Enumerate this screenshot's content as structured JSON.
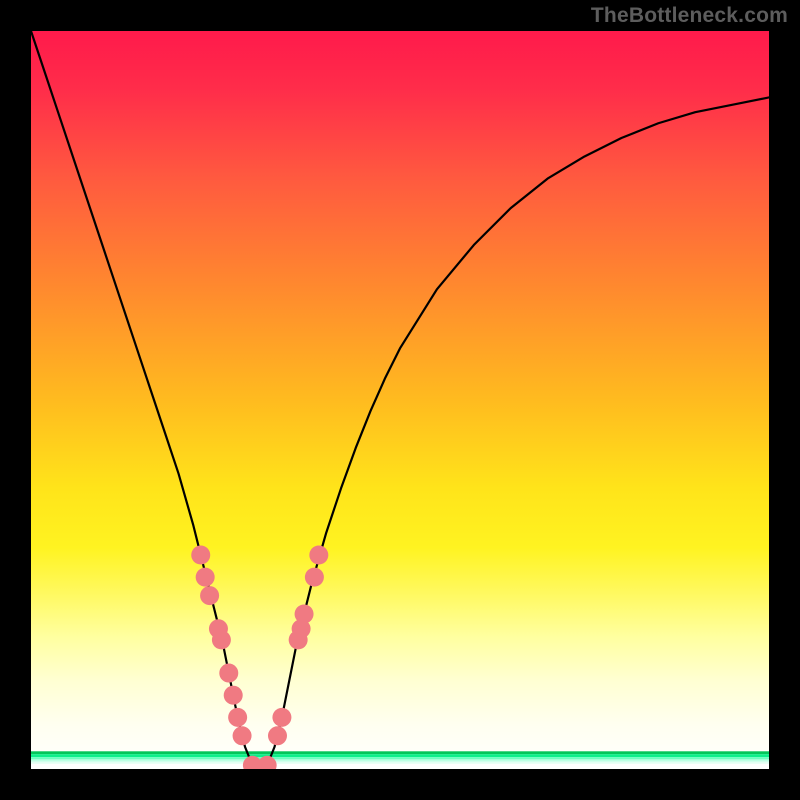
{
  "watermark": "TheBottleneck.com",
  "chart_data": {
    "type": "line",
    "title": "",
    "xlabel": "",
    "ylabel": "",
    "xlim": [
      0,
      100
    ],
    "ylim": [
      0,
      100
    ],
    "grid": false,
    "series": [
      {
        "name": "bottleneck-curve",
        "x": [
          0,
          2,
          4,
          6,
          8,
          10,
          12,
          14,
          16,
          18,
          20,
          22,
          24,
          25,
          26,
          27,
          28,
          29,
          30,
          31,
          32,
          33,
          34,
          35,
          36,
          38,
          40,
          42,
          44,
          46,
          48,
          50,
          55,
          60,
          65,
          70,
          75,
          80,
          85,
          90,
          95,
          100
        ],
        "y": [
          100,
          94,
          88,
          82,
          76,
          70,
          64,
          58,
          52,
          46,
          40,
          33,
          25,
          21,
          17,
          12,
          7,
          3,
          0.5,
          0,
          0.5,
          3,
          7,
          12,
          17,
          25,
          32,
          38,
          43.5,
          48.5,
          53,
          57,
          65,
          71,
          76,
          80,
          83,
          85.5,
          87.5,
          89,
          90,
          91
        ]
      }
    ],
    "markers": {
      "name": "solution-points",
      "color": "#f07a82",
      "points": [
        {
          "x": 23.0,
          "y": 29
        },
        {
          "x": 23.6,
          "y": 26
        },
        {
          "x": 24.2,
          "y": 23.5
        },
        {
          "x": 25.4,
          "y": 19
        },
        {
          "x": 25.8,
          "y": 17.5
        },
        {
          "x": 26.8,
          "y": 13
        },
        {
          "x": 27.4,
          "y": 10
        },
        {
          "x": 28.0,
          "y": 7
        },
        {
          "x": 28.6,
          "y": 4.5
        },
        {
          "x": 30.0,
          "y": 0.5
        },
        {
          "x": 31.0,
          "y": 0
        },
        {
          "x": 32.0,
          "y": 0.5
        },
        {
          "x": 33.4,
          "y": 4.5
        },
        {
          "x": 34.0,
          "y": 7
        },
        {
          "x": 36.2,
          "y": 17.5
        },
        {
          "x": 36.6,
          "y": 19
        },
        {
          "x": 37.0,
          "y": 21
        },
        {
          "x": 38.4,
          "y": 26
        },
        {
          "x": 39.0,
          "y": 29
        }
      ]
    },
    "background": {
      "type": "vertical-gradient-with-bands",
      "stops": [
        {
          "offset": 0.0,
          "color": "#ff1a4b"
        },
        {
          "offset": 0.08,
          "color": "#ff2d4a"
        },
        {
          "offset": 0.2,
          "color": "#ff5a3f"
        },
        {
          "offset": 0.35,
          "color": "#ff8a2e"
        },
        {
          "offset": 0.5,
          "color": "#ffbb1f"
        },
        {
          "offset": 0.62,
          "color": "#ffe41a"
        },
        {
          "offset": 0.7,
          "color": "#fff321"
        },
        {
          "offset": 0.76,
          "color": "#fff95e"
        },
        {
          "offset": 0.82,
          "color": "#ffff9f"
        },
        {
          "offset": 0.88,
          "color": "#ffffd2"
        },
        {
          "offset": 0.94,
          "color": "#fffff0"
        },
        {
          "offset": 1.0,
          "color": "#ffffff"
        }
      ],
      "bands": [
        {
          "y": 97.6,
          "h": 0.4,
          "color": "#03c65a"
        },
        {
          "y": 98.0,
          "h": 0.4,
          "color": "#0df08a"
        },
        {
          "y": 98.4,
          "h": 0.3,
          "color": "#6dffc0"
        },
        {
          "y": 98.7,
          "h": 0.3,
          "color": "#bcffe3"
        },
        {
          "y": 99.0,
          "h": 0.3,
          "color": "#e3fff3"
        },
        {
          "y": 99.3,
          "h": 0.7,
          "color": "#ffffff"
        }
      ]
    }
  }
}
